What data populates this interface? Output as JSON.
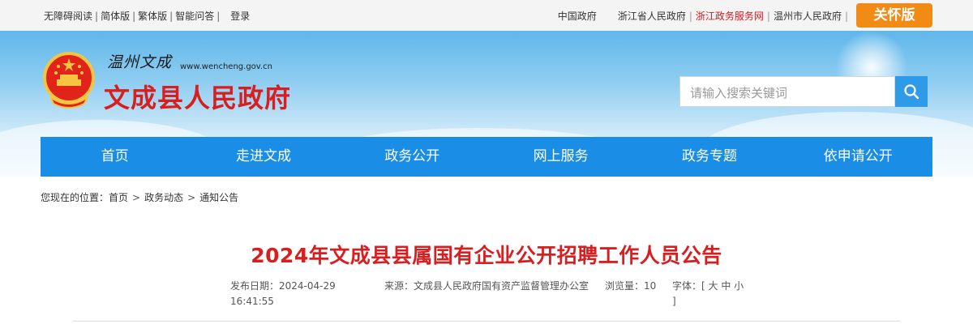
{
  "topbar": {
    "left_links": [
      "无障碍阅读",
      "简体版",
      "繁体版",
      "智能问答"
    ],
    "login": "登录",
    "gov_link": "中国政府",
    "right_links": [
      "浙江省人民政府",
      "浙江政务服务网",
      "温州市人民政府"
    ],
    "care_button": "关怀版"
  },
  "header": {
    "script_name": "温州文成",
    "url": "www.wencheng.gov.cn",
    "site_name": "文成县人民政府"
  },
  "search": {
    "placeholder": "请输入搜索关键词"
  },
  "nav": {
    "items": [
      "首页",
      "走进文成",
      "政务公开",
      "网上服务",
      "政务专题",
      "依申请公开"
    ]
  },
  "breadcrumb": {
    "prefix": "您现在的位置：",
    "items": [
      "首页",
      "政务动态",
      "通知公告"
    ]
  },
  "article": {
    "title": "2024年文成县县属国有企业公开招聘工作人员公告",
    "date_label": "发布日期：",
    "date": "2024-04-29 16:41:55",
    "source_label": "来源：",
    "source": "文成县人民政府国有资产监督管理办公室",
    "views_label": "浏览量：",
    "views": "10",
    "font_label": "字体：",
    "font_options": "[ 大 中 小 ]"
  },
  "colors": {
    "nav_blue": "#1a8ee6",
    "title_red": "#d81e1e",
    "care_orange": "#f28b15"
  }
}
